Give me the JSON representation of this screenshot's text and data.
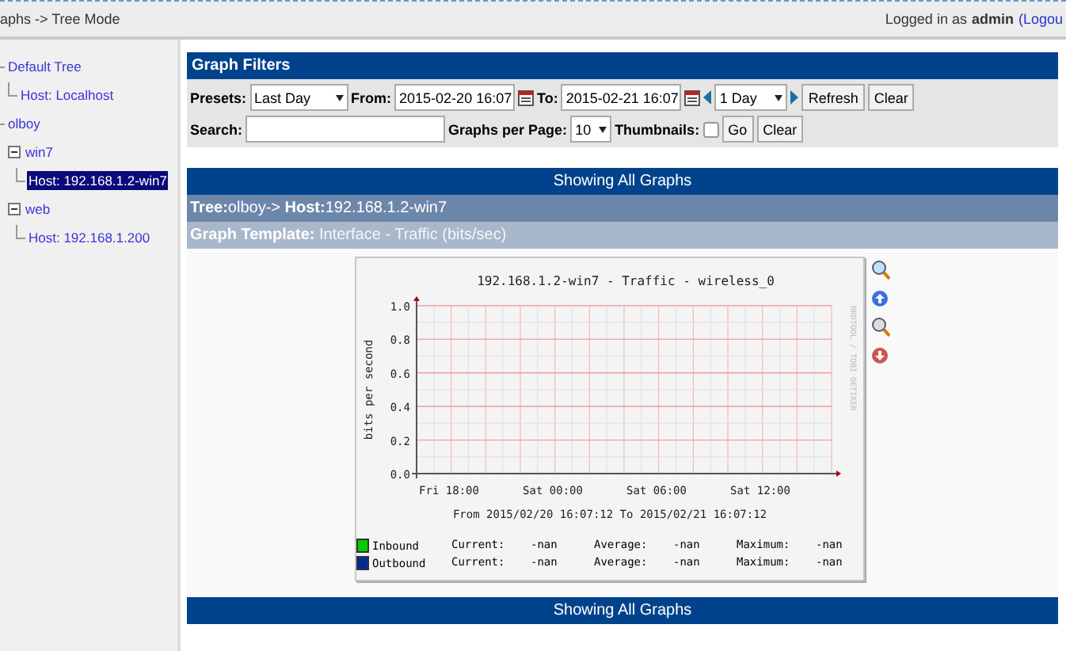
{
  "top_bar": {
    "breadcrumb": "aphs -> Tree Mode",
    "login_prefix": "Logged in as",
    "user": "admin",
    "logout": "(Logou"
  },
  "sidebar": {
    "items": [
      {
        "label": "Default Tree",
        "kind": "tree",
        "selected": false,
        "children": [
          {
            "label": "Host: Localhost",
            "kind": "host",
            "selected": false
          }
        ]
      },
      {
        "label": "olboy",
        "kind": "tree",
        "selected": false,
        "children": [
          {
            "label": "win7",
            "kind": "branch",
            "selected": false,
            "children": [
              {
                "label": "Host: 192.168.1.2-win7",
                "kind": "host",
                "selected": true
              }
            ]
          },
          {
            "label": "web",
            "kind": "branch",
            "selected": false,
            "children": [
              {
                "label": "Host: 192.168.1.200",
                "kind": "host",
                "selected": false
              }
            ]
          }
        ]
      }
    ]
  },
  "filters": {
    "title": "Graph Filters",
    "presets_label": "Presets:",
    "presets_value": "Last Day",
    "from_label": "From:",
    "from_value": "2015-02-20 16:07",
    "to_label": "To:",
    "to_value": "2015-02-21 16:07",
    "span_value": "1 Day",
    "buttons_row1": [
      "Refresh",
      "Clear"
    ],
    "search_label": "Search:",
    "per_page_label": "Graphs per Page:",
    "per_page_value": "10",
    "thumbnails_label": "Thumbnails:",
    "thumbnails_checked": false,
    "buttons_row2": [
      "Go",
      "Clear"
    ]
  },
  "showing_top": "Showing All Graphs",
  "tree_path": "**Tree:**olboy-> **Host:**192.168.1.2-win7",
  "template": "**Graph Template:** Interface - Traffic (bits/sec)",
  "graph": {
    "side_label": "RRDTOOL / TOBI OETIKER",
    "range": "From 2015/02/20 16:07:12 To 2015/02/21 16:07:12",
    "chart_data": {
      "type": "line",
      "grid": true,
      "title": "192.168.1.2-win7 - Traffic - wireless_0",
      "ylabel": "bits per second",
      "ylim": [
        0,
        1
      ],
      "categories": [
        "Fri 18:00",
        "Sat 00:00",
        "Sat 06:00",
        "Sat 12:00"
      ],
      "yticks": [
        {
          "value": 0,
          "label": "0.0"
        },
        {
          "value": 0.2,
          "label": "0.2"
        },
        {
          "value": 0.4,
          "label": "0.4"
        },
        {
          "value": 0.6,
          "label": "0.6"
        },
        {
          "value": 0.8,
          "label": "0.8"
        },
        {
          "value": 1,
          "label": "1.0"
        }
      ]
    },
    "legend": [
      {
        "name": "Inbound",
        "color": "#00cf00",
        "stats": [
          "Current:",
          "-nan",
          "Average:",
          "-nan",
          "Maximum:",
          "-nan"
        ]
      },
      {
        "name": "Outbound",
        "color": "#002a97",
        "stats": [
          "Current:",
          "-nan",
          "Average:",
          "-nan",
          "Maximum:",
          "-nan"
        ]
      }
    ]
  },
  "showing_bottom": "Showing All Graphs"
}
